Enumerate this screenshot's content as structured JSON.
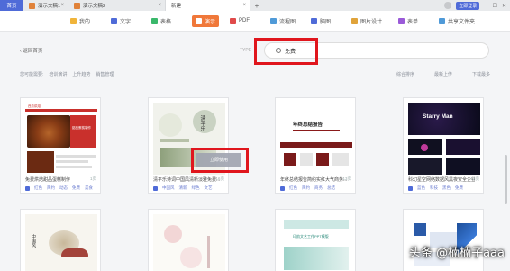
{
  "titlebar": {
    "home": "首页",
    "tabs": [
      {
        "label": "演示文稿1",
        "color": "#e0823a"
      },
      {
        "label": "演示文稿2",
        "color": "#e0823a"
      },
      {
        "label": "新建",
        "color": "#ffffff"
      }
    ],
    "plus": "+",
    "badge": "立即登录"
  },
  "categories": [
    {
      "label": "我的",
      "icon": "star-icon",
      "color": "#f0b43a"
    },
    {
      "label": "文字",
      "icon": "doc-icon",
      "color": "#4f6bd8"
    },
    {
      "label": "表格",
      "icon": "sheet-icon",
      "color": "#3ab86b"
    },
    {
      "label": "演示",
      "icon": "ppt-icon",
      "color": "#f0783a",
      "active": true
    },
    {
      "label": "PDF",
      "icon": "pdf-icon",
      "color": "#e04a4a"
    },
    {
      "label": "流程图",
      "icon": "flow-icon",
      "color": "#4f9ad8"
    },
    {
      "label": "脑图",
      "icon": "mind-icon",
      "color": "#4f6bd8"
    },
    {
      "label": "图片设计",
      "icon": "image-icon",
      "color": "#e0a33a"
    },
    {
      "label": "表单",
      "icon": "form-icon",
      "color": "#9a5ad8"
    },
    {
      "label": "共享文件夹",
      "icon": "share-icon",
      "color": "#4f9ad8"
    }
  ],
  "back": "返回首页",
  "search": {
    "label": "TYPE",
    "value": "免费"
  },
  "filters": {
    "label": "您可能需要:",
    "items": [
      "培训演讲",
      "上升趋势",
      "销售管理"
    ]
  },
  "sorts": [
    "综合排序",
    "最新上传",
    "下载最多"
  ],
  "cards_row1": [
    {
      "title": "免费烘焙甜品蛋糕制作",
      "num": "1页",
      "tags": [
        "红色",
        "简约",
        "动态",
        "免费",
        "美食"
      ]
    },
    {
      "title": "清平乐诗词中国风清新淡雅免费...",
      "num": "16页",
      "tags": [
        "中国风",
        "清新",
        "绿色",
        "文艺"
      ]
    },
    {
      "title": "年终总结报告简约实红大气商务...",
      "num": "13页",
      "tags": [
        "红色",
        "简约",
        "商务",
        "总结"
      ]
    },
    {
      "title": "科幻星空网络数据风黑夜安全企业...",
      "num": "13页",
      "tags": [
        "蓝色",
        "科技",
        "黑色",
        "免费"
      ]
    }
  ],
  "use_button": "立即使用",
  "card_texts": {
    "c1_header": "西点烘焙",
    "c1_sub": "甜品蛋糕制作",
    "c2_title": "清平乐",
    "c3_title": "年终总结报告",
    "c4_title": "Starry Man",
    "r2c1_title": "中国风",
    "r2c3_title": "印韵文艺工作PPT模版"
  },
  "watermark": "头条 @楠楠子aaa",
  "colors": {
    "accent": "#f0783a",
    "highlight": "#e0161d",
    "brand": "#4f6bd8"
  }
}
